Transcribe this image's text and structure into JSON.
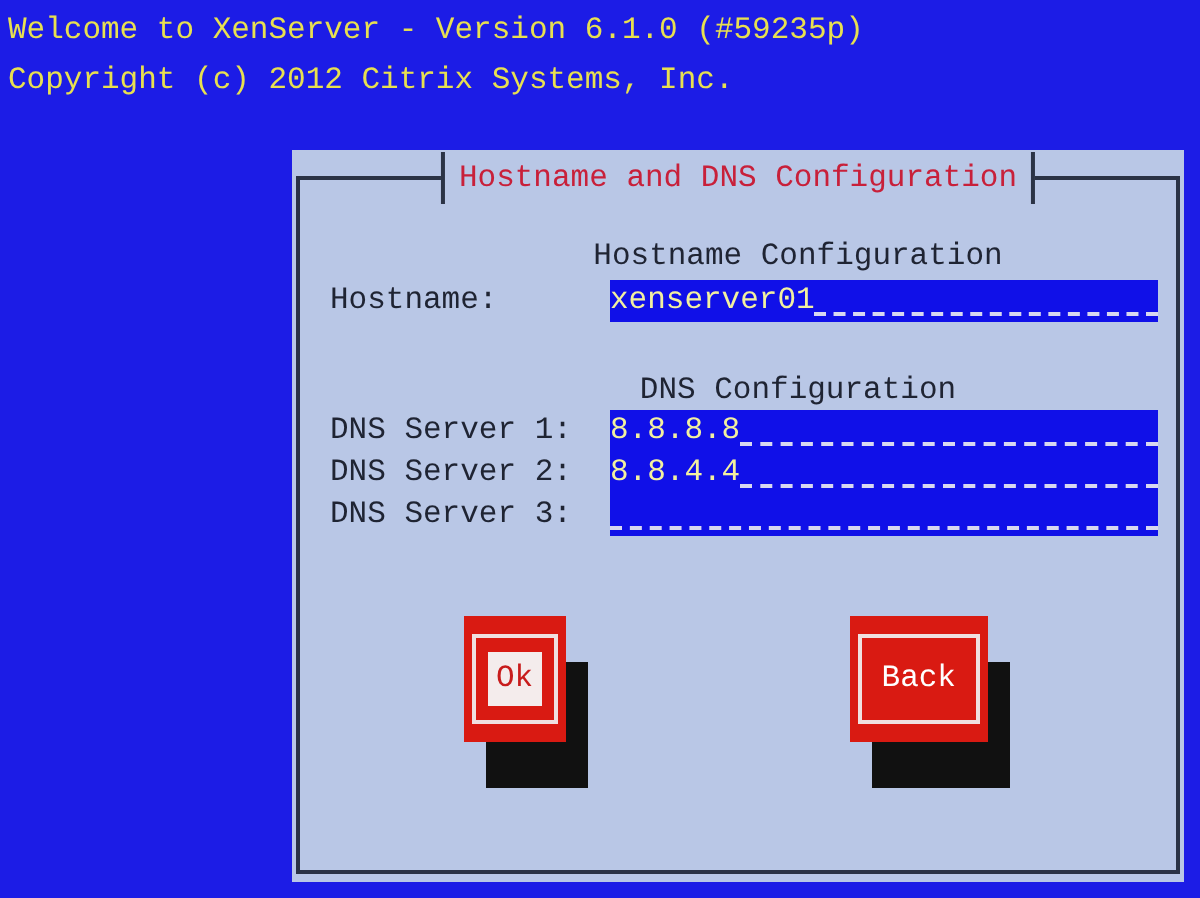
{
  "header": {
    "lines": [
      "Welcome to XenServer - Version 6.1.0 (#59235p)",
      "Copyright (c) 2012 Citrix Systems, Inc."
    ]
  },
  "dialog": {
    "title": "Hostname and DNS Configuration",
    "sections": [
      {
        "heading": "Hostname Configuration",
        "fields": [
          {
            "label": "Hostname:",
            "value": "xenserver01"
          }
        ]
      },
      {
        "heading": "DNS Configuration",
        "fields": [
          {
            "label": "DNS Server 1:",
            "value": "8.8.8.8"
          },
          {
            "label": "DNS Server 2:",
            "value": "8.8.4.4"
          },
          {
            "label": "DNS Server 3:"
          }
        ]
      }
    ],
    "buttons": [
      {
        "label": "Ok",
        "focused": true
      },
      {
        "label": "Back",
        "focused": false
      }
    ]
  }
}
